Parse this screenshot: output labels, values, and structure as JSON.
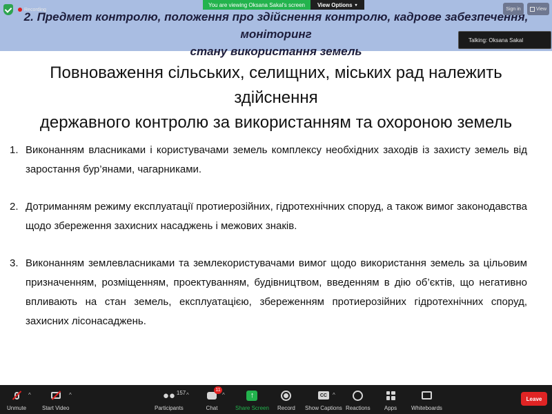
{
  "top_bar": {
    "recording_label": "Recording",
    "viewing_text": "You are viewing Oksana Sakal's screen",
    "view_options_label": "View Options",
    "sign_in_label": "Sign in",
    "view_label": "View",
    "talking_text": "Talking: Oksana Sakal"
  },
  "slide": {
    "header_line1": "2. Предмет контролю, положення про здійснення контролю, кадрове забезпечення, моніторинг",
    "header_line2": "стану використання земель",
    "heading_line1": "Повноваження сільських, селищних, міських рад належить здійснення",
    "heading_line2": "державного контролю за використанням та охороною земель",
    "items": [
      {
        "number": "1.",
        "text": "Виконанням власниками і користувачами земель комплексу необхідних заходів із захисту земель від заростання бур’янами, чагарниками."
      },
      {
        "number": "2.",
        "text": "Дотриманням режиму експлуатації протиерозійних, гідротехнічних споруд, а також вимог законодавства щодо збереження захисних насаджень і межових знаків."
      },
      {
        "number": "3.",
        "text": "Виконанням землевласниками та землекористувачами вимог щодо використання земель за цільовим призначенням, розміщенням, проектуванням, будівництвом, введенням в дію об’єктів, що негативно впливають на стан земель, експлуатацією, збереженням протиерозійних гідротехнічних споруд, захисних лісонасаджень."
      }
    ]
  },
  "toolbar": {
    "unmute_label": "Unmute",
    "start_video_label": "Start Video",
    "participants_label": "Participants",
    "participants_count": "157",
    "chat_label": "Chat",
    "chat_badge": "11",
    "share_screen_label": "Share Screen",
    "record_label": "Record",
    "captions_label": "Show Captions",
    "cc_text": "CC",
    "reactions_label": "Reactions",
    "apps_label": "Apps",
    "whiteboards_label": "Whiteboards",
    "leave_label": "Leave"
  },
  "colors": {
    "header_band": "#a9bde2",
    "share_green": "#23b34d",
    "leave_red": "#e02424",
    "toolbar_bg": "#1a1a1a"
  },
  "icons": [
    "shield-check-icon",
    "recording-dot-icon",
    "grid-view-icon",
    "microphone-muted-icon",
    "video-off-icon",
    "participants-icon",
    "chat-icon",
    "share-screen-icon",
    "record-icon",
    "captions-icon",
    "reactions-icon",
    "apps-icon",
    "whiteboard-icon"
  ]
}
